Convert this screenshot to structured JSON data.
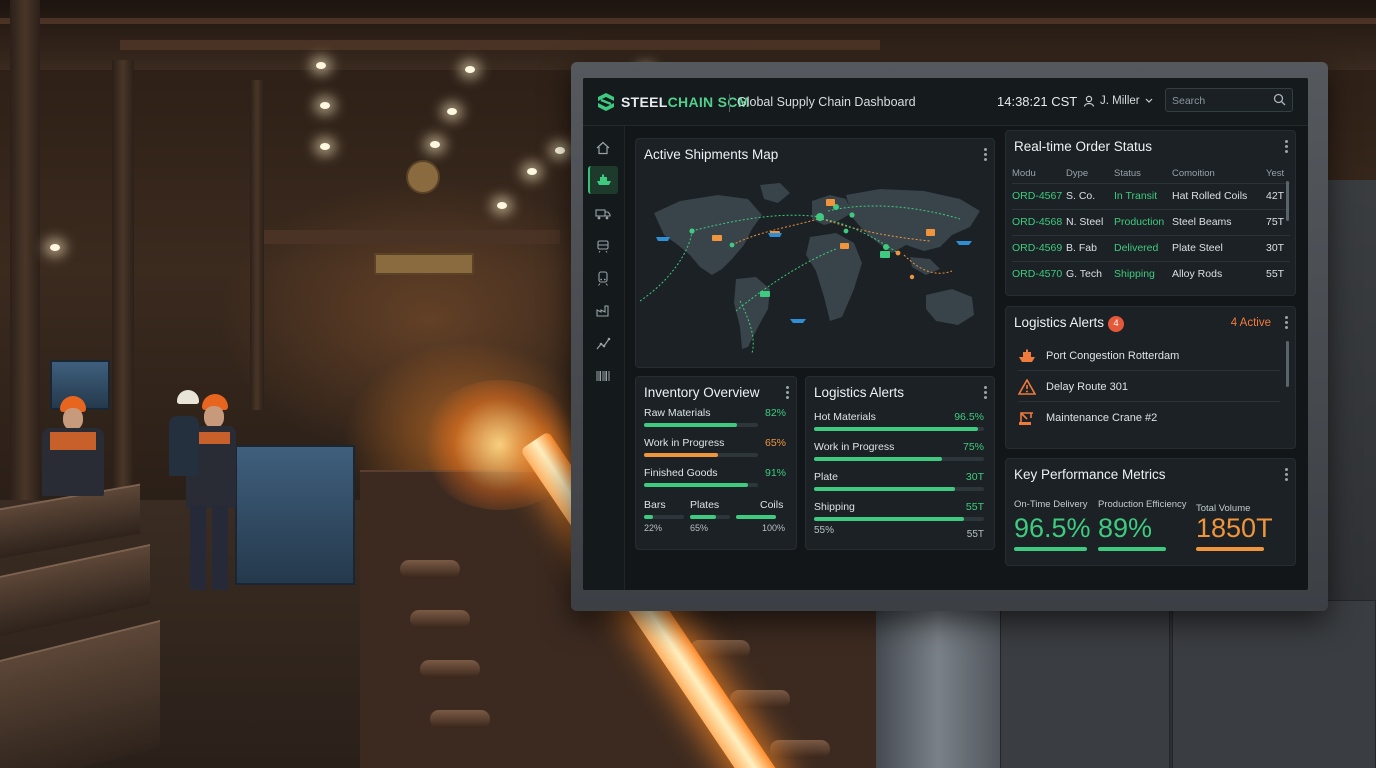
{
  "app": {
    "brand_prefix": "STEEL",
    "brand_suffix": "CHAIN SCM",
    "title": "Global Supply Chain Dashboard",
    "clock": "14:38:21 CST",
    "user": "J. Miller",
    "search_placeholder": "Search"
  },
  "colors": {
    "accent_green": "#3ecb7f",
    "accent_orange": "#f07a3c",
    "panel_bg": "#1b2125",
    "screen_bg": "#121619"
  },
  "sidebar": {
    "items": [
      {
        "icon": "home-icon"
      },
      {
        "icon": "ship-icon",
        "active": true
      },
      {
        "icon": "truck-icon"
      },
      {
        "icon": "train-icon"
      },
      {
        "icon": "rail-icon"
      },
      {
        "icon": "factory-icon"
      },
      {
        "icon": "analytics-icon"
      },
      {
        "icon": "barcode-icon"
      }
    ]
  },
  "map_panel": {
    "title": "Active Shipments Map"
  },
  "orders_panel": {
    "title": "Real-time Order Status",
    "columns": [
      "Modu",
      "Dype",
      "Status",
      "Comoition",
      "Yest"
    ],
    "rows": [
      {
        "id": "ORD-4567",
        "type": "S. Co.",
        "status": "In Transit",
        "product": "Hat Rolled Coils",
        "qty": "42T"
      },
      {
        "id": "ORD-4568",
        "type": "N. Steel",
        "status": "Production",
        "product": "Steel Beams",
        "qty": "75T"
      },
      {
        "id": "ORD-4569",
        "type": "B. Fab",
        "status": "Delivered",
        "product": "Plate Steel",
        "qty": "30T"
      },
      {
        "id": "ORD-4570",
        "type": "G. Tech",
        "status": "Shipping",
        "product": "Alloy Rods",
        "qty": "55T"
      }
    ]
  },
  "alerts_panel": {
    "title": "Logistics Alerts",
    "badge": "4",
    "active_label": "4 Active",
    "items": [
      {
        "icon": "ship-alert-icon",
        "text": "Port Congestion Rotterdam"
      },
      {
        "icon": "warning-icon",
        "text": "Delay Route 301"
      },
      {
        "icon": "crane-icon",
        "text": "Maintenance Crane #2"
      }
    ]
  },
  "inventory_panel": {
    "title": "Inventory Overview",
    "items": [
      {
        "label": "Raw Materials",
        "value": "82%",
        "fraction": 0.82,
        "color": "#3ecb7f"
      },
      {
        "label": "Work in Progress",
        "value": "65%",
        "fraction": 0.65,
        "color": "#f0953c"
      },
      {
        "label": "Finished Goods",
        "value": "91%",
        "fraction": 0.91,
        "color": "#3ecb7f"
      }
    ],
    "mini": [
      {
        "label": "Bars",
        "pct": "22%",
        "fraction": 0.22
      },
      {
        "label": "Plates",
        "pct": "65%",
        "fraction": 0.65
      },
      {
        "label": "Coils",
        "pct": "100%",
        "fraction": 1.0
      }
    ]
  },
  "logistics_bars_panel": {
    "title": "Logistics Alerts",
    "items": [
      {
        "label": "Hot Materials",
        "value": "96.5%",
        "fraction": 0.965
      },
      {
        "label": "Work in Progress",
        "value": "75%",
        "fraction": 0.75
      },
      {
        "label": "Plate",
        "value": "30T",
        "fraction": 0.83
      },
      {
        "label": "Shipping",
        "value": "55T",
        "fraction": 0.88
      }
    ],
    "footer_left": "55%",
    "footer_right": "55T"
  },
  "kpi_panel": {
    "title": "Key Performance Metrics",
    "metrics": [
      {
        "label": "On-Time Delivery",
        "value": "96.5%",
        "color": "#3ecb7f",
        "fraction": 0.965
      },
      {
        "label": "Production Efficiency",
        "value": "89%",
        "color": "#3ecb7f",
        "fraction": 0.89
      },
      {
        "label": "Total Volume",
        "value": "1850T",
        "color": "#f0953c",
        "fraction": 0.9
      }
    ]
  }
}
